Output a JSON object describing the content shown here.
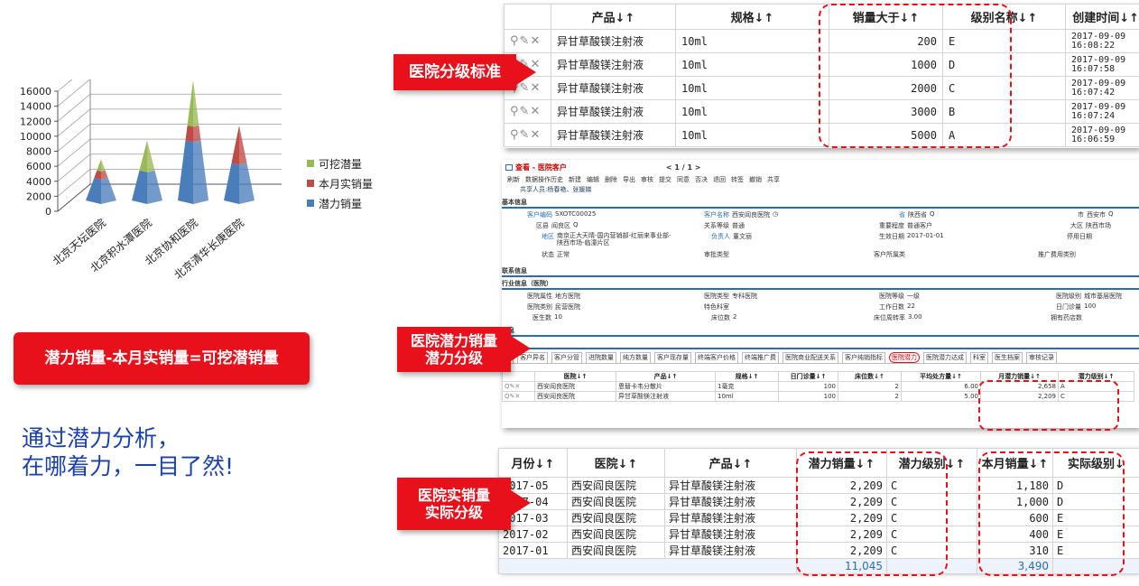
{
  "chart_data": {
    "type": "bar",
    "categories": [
      "北京天坛医院",
      "北京积水潭医院",
      "北京协和医院",
      "北京清华长庚医院"
    ],
    "series": [
      {
        "name": "潜力销量",
        "values": [
          3000,
          4000,
          8000,
          5000
        ],
        "color": "#4a7ebb"
      },
      {
        "name": "本月实销量",
        "values": [
          1000,
          0,
          2000,
          5000
        ],
        "color": "#be4b48"
      },
      {
        "name": "可挖潜量",
        "values": [
          1500,
          4000,
          6000,
          0
        ],
        "color": "#98b954"
      }
    ],
    "ylim": [
      0,
      16000
    ],
    "yticks": [
      "16000",
      "14000",
      "12000",
      "10000",
      "8000",
      "6000",
      "4000",
      "2000",
      "0"
    ],
    "legend": "right"
  },
  "legend": [
    "可挖潜量",
    "本月实销量",
    "潜力销量"
  ],
  "labels": {
    "standard": "医院分级标准",
    "potential": "医院潜力销量\n潜力分级",
    "actual": "医院实销量\n实际分级",
    "formula": "潜力销量-本月实销量=可挖潜销量",
    "tagline1": "通过潜力分析，",
    "tagline2": "在哪着力，一目了然!"
  },
  "panel1": {
    "headers": [
      "",
      "产品↓↑",
      "规格↓↑",
      "销量大于↓↑",
      "级别名称↓↑",
      "创建时间↓↑"
    ],
    "rows": [
      {
        "product": "异甘草酸镁注射液",
        "spec": "10ml",
        "sales": "200",
        "level": "E",
        "time": "2017-09-09\n16:08:22"
      },
      {
        "product": "异甘草酸镁注射液",
        "spec": "10ml",
        "sales": "1000",
        "level": "D",
        "time": "2017-09-09\n16:07:58"
      },
      {
        "product": "异甘草酸镁注射液",
        "spec": "10ml",
        "sales": "2000",
        "level": "C",
        "time": "2017-09-09\n16:07:42"
      },
      {
        "product": "异甘草酸镁注射液",
        "spec": "10ml",
        "sales": "3000",
        "level": "B",
        "time": "2017-09-09\n16:07:24"
      },
      {
        "product": "异甘草酸镁注射液",
        "spec": "10ml",
        "sales": "5000",
        "level": "A",
        "time": "2017-09-09\n16:06:59"
      }
    ]
  },
  "panel2": {
    "title": "查看 - 医院客户",
    "pager": "< 1 / 1 >",
    "toolbar": [
      "刷新",
      "数据操作历史",
      "新建",
      "编辑",
      "删除",
      "导出",
      "审核",
      "提交",
      "同意",
      "否决",
      "退回",
      "转签",
      "撤销",
      "共享"
    ],
    "sharers": "共享人员:杨春艳、张媛娣",
    "sec_basic": "基本信息",
    "f_code_l": "客户编码",
    "f_code_v": "SXOTC00025",
    "f_name_l": "客户名称",
    "f_name_v": "西安阎良医院",
    "f_prov_l": "省",
    "f_prov_v": "陕西省",
    "f_city_l": "市",
    "f_city_v": "西安市",
    "f_area_l": "区县",
    "f_area_v": "阎良区",
    "f_rel_l": "关系等级",
    "f_rel_v": "普通",
    "f_imp_l": "重要程度",
    "f_imp_v": "普通客户",
    "f_region_l": "大区",
    "f_region_v": "陕西市场",
    "f_dist_l": "地区",
    "f_dist_v": "南京正大天晴-国内营销部-红丽来事业部-陕西市场-临潼片区",
    "f_owner_l": "负责人",
    "f_owner_v": "董文丽",
    "f_eff_l": "生效日期",
    "f_eff_v": "2017-01-01",
    "f_stop_l": "停用日期",
    "f_state_l": "状态",
    "f_state_v": "正常",
    "f_approve_l": "审批类型",
    "f_belong_l": "客户所属类",
    "f_promo_l": "推广费用类别",
    "sec_contact": "联系信息",
    "sec_industry": "行业信息（医院）",
    "f_attr_l": "医院属性",
    "f_attr_v": "地方医院",
    "f_type_l": "医院类型",
    "f_type_v": "专科医院",
    "f_grade_l": "医院等级",
    "f_grade_v": "一级",
    "f_hlevel_l": "医院级别",
    "f_hlevel_v": "城市基层医院",
    "f_cat_l": "医院类别",
    "f_cat_v": "民营医院",
    "f_feat_l": "特色科室",
    "f_work_l": "工作日数",
    "f_work_v": "22",
    "f_opd_l": "日门诊量",
    "f_opd_v": "100",
    "f_doc_l": "医生数",
    "f_doc_v": "10",
    "f_bed_l": "床位数",
    "f_bed_v": "2",
    "f_turn_l": "床位周转率",
    "f_turn_v": "3.00",
    "f_pharm_l": "拥有药店数",
    "sec_x1": "信息",
    "sec_x2": "信息",
    "tabs": [
      "动",
      "客户异名",
      "客户分管",
      "进院数量",
      "纯方数量",
      "客户现存量",
      "终端客户价格",
      "终端推广费",
      "医院商业配送关系",
      "客户纯销指标",
      "医院潜力",
      "医院潜力达成",
      "科室",
      "医生档案",
      "审核记录"
    ],
    "grid_headers": [
      "",
      "医院↓↑",
      "产品↓↑",
      "规格↓↑",
      "日门诊量↓↑",
      "床位数↓↑",
      "平均处方量↓↑",
      "月潜力销量↓↑",
      "潜力级别↓↑"
    ],
    "grid_rows": [
      [
        "西安阎良医院",
        "恩替卡韦分散片",
        "1毫克",
        "100",
        "2",
        "6.00",
        "2,658",
        "A"
      ],
      [
        "西安阎良医院",
        "异甘草酸镁注射液",
        "10ml",
        "100",
        "2",
        "5.00",
        "2,209",
        "C"
      ]
    ]
  },
  "panel3": {
    "headers": [
      "月份↓↑",
      "医院↓↑",
      "产品↓↑",
      "潜力销量↓↑",
      "潜力级别↓↑",
      "本月销量↓↑",
      "实际级别↓"
    ],
    "rows": [
      [
        "2017-05",
        "西安阎良医院",
        "异甘草酸镁注射液",
        "2,209",
        "C",
        "1,180",
        "D"
      ],
      [
        "2017-04",
        "西安阎良医院",
        "异甘草酸镁注射液",
        "2,209",
        "C",
        "1,000",
        "D"
      ],
      [
        "2017-03",
        "西安阎良医院",
        "异甘草酸镁注射液",
        "2,209",
        "C",
        "600",
        "E"
      ],
      [
        "2017-02",
        "西安阎良医院",
        "异甘草酸镁注射液",
        "2,209",
        "C",
        "400",
        "E"
      ],
      [
        "2017-01",
        "西安阎良医院",
        "异甘草酸镁注射液",
        "2,209",
        "C",
        "310",
        "E"
      ]
    ],
    "total_potential": "11,045",
    "total_actual": "3,490"
  },
  "colors": {
    "accent_red": "#e8111b",
    "tagline_blue": "#1a3fb0",
    "section_blue": "#2a6db5"
  }
}
